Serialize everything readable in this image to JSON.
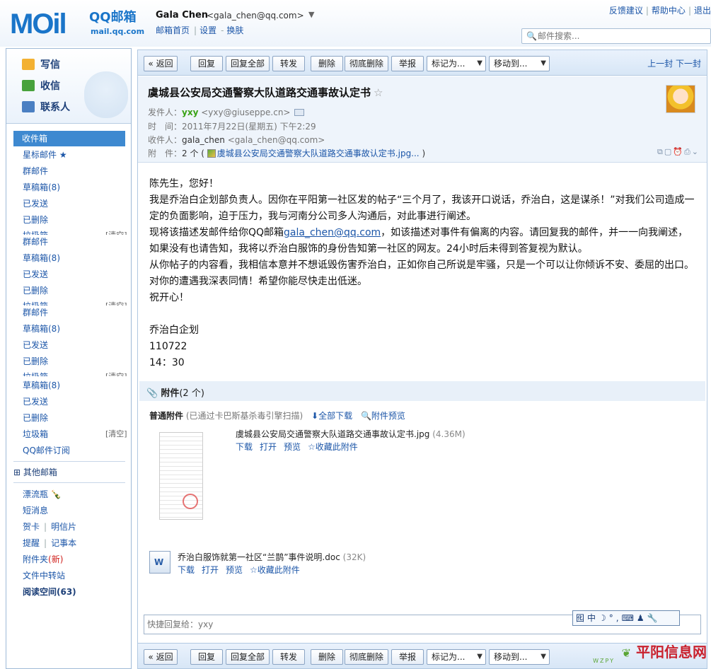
{
  "header": {
    "logo_main": "MOil",
    "logo_brand": "QQ邮箱",
    "logo_domain": "mail.qq.com",
    "user_name": "Gala Chen",
    "user_email": "<gala_chen@qq.com>",
    "links": [
      "邮箱首页",
      "设置",
      "换肤"
    ],
    "right_links": [
      "反馈建议",
      "帮助中心",
      "退出"
    ],
    "search_placeholder": "邮件搜索..."
  },
  "sidebar": {
    "quick": [
      "写信",
      "收信",
      "联系人"
    ],
    "folders": [
      {
        "label": "收件箱",
        "active": true
      },
      {
        "label": "星标邮件 ★"
      },
      {
        "label": "群邮件"
      },
      {
        "label": "草稿箱(8)"
      },
      {
        "label": "已发送"
      },
      {
        "label": "已删除"
      },
      {
        "label": "垃圾箱"
      },
      {
        "label": "群邮件"
      },
      {
        "label": "草稿箱(8)"
      },
      {
        "label": "已发送"
      },
      {
        "label": "已删除"
      },
      {
        "label": "垃圾箱"
      },
      {
        "label": "群邮件"
      },
      {
        "label": "草稿箱(8)"
      },
      {
        "label": "已发送"
      },
      {
        "label": "已删除"
      },
      {
        "label": "垃圾箱"
      },
      {
        "label": "草稿箱(8)"
      },
      {
        "label": "已发送"
      },
      {
        "label": "已删除"
      },
      {
        "label": "垃圾箱"
      },
      {
        "label": "QQ邮件订阅"
      }
    ],
    "clear_label": "[清空]",
    "other_mailboxes": "其他邮箱",
    "apps": [
      "漂流瓶",
      "短消息",
      "贺卡",
      "明信片",
      "提醒",
      "记事本",
      "附件夹",
      "(新)",
      "文件中转站",
      "阅读空间(63)"
    ]
  },
  "toolbar": {
    "back": "« 返回",
    "reply": "回复",
    "reply_all": "回复全部",
    "forward": "转发",
    "delete": "删除",
    "delete_forever": "彻底删除",
    "report": "举报",
    "mark_as": "标记为...",
    "move_to": "移动到...",
    "prev": "上一封",
    "next": "下一封"
  },
  "mail": {
    "subject": "虞城县公安局交通警察大队道路交通事故认定书",
    "from_label": "发件人：",
    "from_name": "yxy",
    "from_email": "<yxy@giuseppe.cn>",
    "time_label": "时　间：",
    "time": "2011年7月22日(星期五) 下午2:29",
    "to_label": "收件人：",
    "to_name": "gala_chen",
    "to_email": "<gala_chen@qq.com>",
    "attach_label": "附　件：",
    "attach_count": "2 个 (",
    "attach_inline_name": "虞城县公安局交通警察大队道路交通事故认定书.jpg...",
    "attach_close": ")",
    "body": [
      "陈先生，您好！",
      "我是乔治白企划部负责人。因你在平阳第一社区发的帖子“三个月了，我该开口说话，乔治白，这是谋杀！”对我们公司造成一",
      "定的负面影响，迫于压力，我与河南分公司多人沟通后，对此事进行阐述。",
      "现将该描述发邮件给你QQ邮箱",
      "gala_chen@qq.com",
      "，如该描述对事件有偏离的内容。请回复我的邮件，并一一向我阐述，",
      "如果没有也请告知，我将以乔治白服饰的身份告知第一社区的网友。24小时后未得到答复视为默认。",
      "从你帖子的内容看，我相信本意并不想诋毁伤害乔治白，正如你自己所说是牢骚，只是一个可以让你倾诉不安、委屈的出口。",
      "对你的遭遇我深表同情！希望你能尽快走出低迷。",
      "祝开心！",
      "",
      "乔治白企划",
      "110722",
      "14：30"
    ]
  },
  "attachments": {
    "title": "附件",
    "count": "(2 个)",
    "normal_label": "普通附件",
    "scan_note": "(已通过卡巴斯基杀毒引擎扫描)",
    "download_all": "全部下载",
    "preview_all": "附件预览",
    "files": [
      {
        "name": "虞城县公安局交通警察大队道路交通事故认定书.jpg",
        "size": "(4.36M)",
        "actions": [
          "下载",
          "打开",
          "预览",
          "☆收藏此附件"
        ]
      },
      {
        "name": "乔治白服饰就第一社区“兰鹊”事件说明.doc",
        "size": "(32K)",
        "actions": [
          "下载",
          "打开",
          "预览",
          "☆收藏此附件"
        ]
      }
    ]
  },
  "quick_reply_placeholder": "快捷回复给：yxy",
  "ime_bar": "囮中☽°,⌨♟🔧",
  "watermark": {
    "main": "平阳信息网",
    "sub": "WZPY"
  }
}
